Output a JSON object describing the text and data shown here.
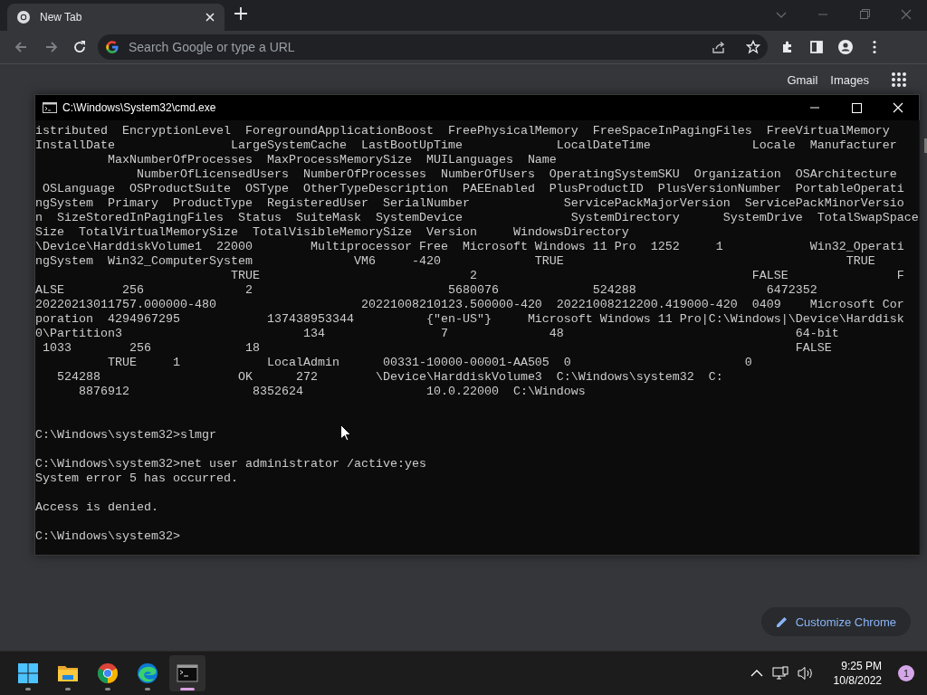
{
  "browser": {
    "tab": {
      "title": "New Tab",
      "selected": true
    },
    "omnibox": {
      "placeholder": "Search Google or type a URL"
    },
    "page_links": [
      "Gmail",
      "Images"
    ],
    "customize_button": "Customize Chrome"
  },
  "console_window": {
    "title": "C:\\Windows\\System32\\cmd.exe",
    "lines": [
      {
        "kind": "text",
        "text": "istributed  EncryptionLevel  ForegroundApplicationBoost  FreePhysicalMemory  FreeSpaceInPagingFiles  FreeVirtualMemory"
      },
      {
        "kind": "text",
        "text": "InstallDate                LargeSystemCache  LastBootUpTime             LocalDateTime              Locale  Manufacturer"
      },
      {
        "kind": "text",
        "text": "          MaxNumberOfProcesses  MaxProcessMemorySize  MUILanguages  Name"
      },
      {
        "kind": "text",
        "text": "              NumberOfLicensedUsers  NumberOfProcesses  NumberOfUsers  OperatingSystemSKU  Organization  OSArchitecture"
      },
      {
        "kind": "text",
        "text": " OSLanguage  OSProductSuite  OSType  OtherTypeDescription  PAEEnabled  PlusProductID  PlusVersionNumber  PortableOperati"
      },
      {
        "kind": "text",
        "text": "ngSystem  Primary  ProductType  RegisteredUser  SerialNumber             ServicePackMajorVersion  ServicePackMinorVersio"
      },
      {
        "kind": "text",
        "text": "n  SizeStoredInPagingFiles  Status  SuiteMask  SystemDevice               SystemDirectory      SystemDrive  TotalSwapSpace"
      },
      {
        "kind": "text",
        "text": "Size  TotalVirtualMemorySize  TotalVisibleMemorySize  Version     WindowsDirectory"
      },
      {
        "kind": "text",
        "text": "\\Device\\HarddiskVolume1  22000        Multiprocessor Free  Microsoft Windows 11 Pro  1252     1            Win32_Operati"
      },
      {
        "kind": "text",
        "text": "ngSystem  Win32_ComputerSystem              VM6     -420             TRUE                                       TRUE"
      },
      {
        "kind": "text",
        "text": "                           TRUE                             2                                      FALSE               F"
      },
      {
        "kind": "text",
        "text": "ALSE        256              2                           5680076             524288                  6472352"
      },
      {
        "kind": "text",
        "text": "20220213011757.000000-480                    20221008210123.500000-420  20221008212200.419000-420  0409    Microsoft Cor"
      },
      {
        "kind": "text",
        "text": "poration  4294967295            137438953344          {\"en-US\"}     Microsoft Windows 11 Pro|C:\\Windows|\\Device\\Harddisk"
      },
      {
        "kind": "text",
        "text": "0\\Partition3                         134                7              48                                64-bit"
      },
      {
        "kind": "text",
        "text": " 1033        256             18                                                                          FALSE"
      },
      {
        "kind": "text",
        "text": "          TRUE     1            LocalAdmin      00331-10000-00001-AA505  0                        0"
      },
      {
        "kind": "text",
        "text": "   524288                   OK      272        \\Device\\HarddiskVolume3  C:\\Windows\\system32  C:"
      },
      {
        "kind": "text",
        "text": "      8876912                 8352624                 10.0.22000  C:\\Windows"
      },
      {
        "kind": "blank"
      },
      {
        "kind": "blank"
      },
      {
        "kind": "text",
        "text": "C:\\Windows\\system32>slmgr"
      },
      {
        "kind": "blank"
      },
      {
        "kind": "text",
        "text": "C:\\Windows\\system32>net user administrator /active:yes"
      },
      {
        "kind": "text",
        "text": "System error 5 has occurred."
      },
      {
        "kind": "blank"
      },
      {
        "kind": "text",
        "text": "Access is denied."
      },
      {
        "kind": "blank"
      },
      {
        "kind": "text",
        "text": "C:\\Windows\\system32>"
      }
    ]
  },
  "taskbar": {
    "apps": [
      {
        "kind": "start",
        "selected": false
      },
      {
        "kind": "explorer",
        "selected": false
      },
      {
        "kind": "chrome",
        "selected": false
      },
      {
        "kind": "edge",
        "selected": false
      },
      {
        "kind": "terminal",
        "selected": true
      }
    ],
    "time": "9:25 PM",
    "date": "10/8/2022",
    "notification_count": "1"
  }
}
